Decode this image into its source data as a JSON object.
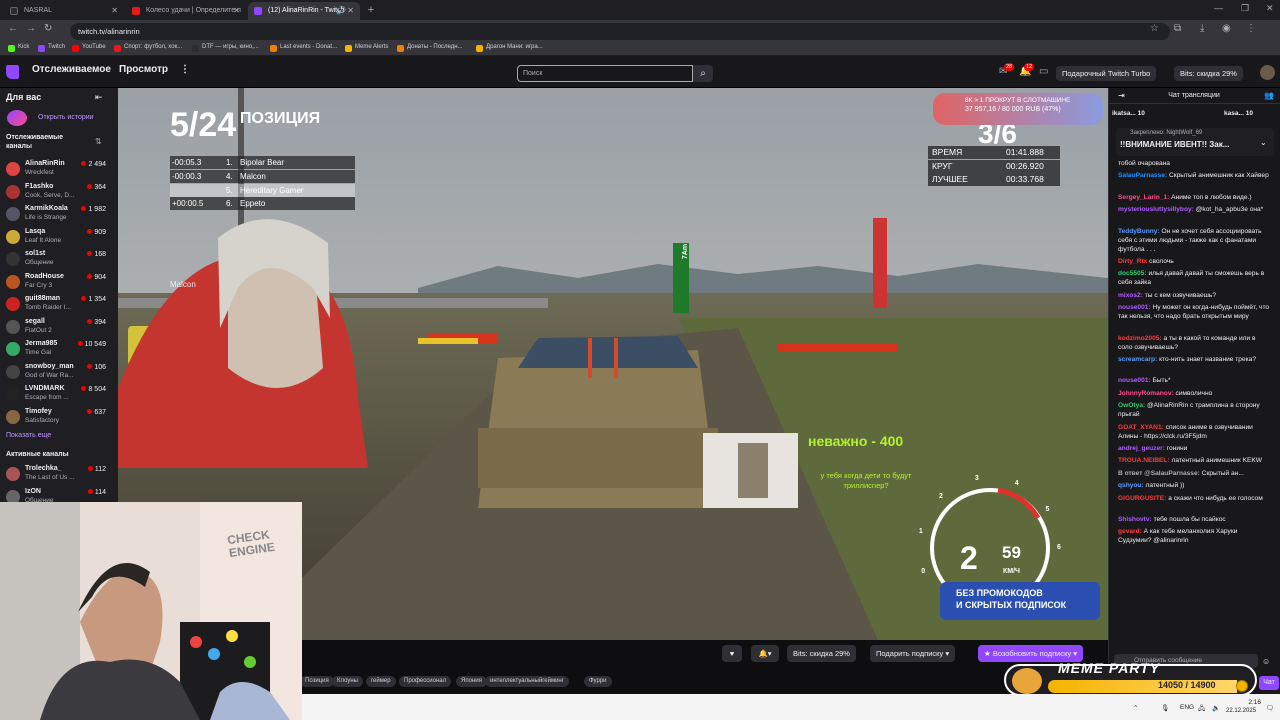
{
  "browser": {
    "tabs": [
      {
        "title": "NASRAL",
        "color": "#2d2d2d"
      },
      {
        "title": "Колесо удачи | Определите п",
        "color": "#e91916"
      },
      {
        "title": "(12) AlinaRinRin - Twitch",
        "color": "#9147ff"
      }
    ],
    "url": "twitch.tv/alinarinrin",
    "bookmarks": [
      {
        "label": "Kick",
        "color": "#53fc18"
      },
      {
        "label": "Twitch",
        "color": "#9147ff"
      },
      {
        "label": "YouTube",
        "color": "#ff0000"
      },
      {
        "label": "Спорт: футбол, хок...",
        "color": "#e91916"
      },
      {
        "label": "DTF — игры, кино,...",
        "color": "#2d2d2d"
      },
      {
        "label": "Last events - Donat...",
        "color": "#f57d07"
      },
      {
        "label": "Meme Alerts",
        "color": "#f5b300"
      },
      {
        "label": "Донаты - Последн...",
        "color": "#f57d07"
      },
      {
        "label": "Драгон Мани: игра...",
        "color": "#f5b300"
      }
    ]
  },
  "twitch": {
    "nav": {
      "following": "Отслеживаемое",
      "browse": "Просмотр",
      "more": "⋮"
    },
    "search_placeholder": "Поиск",
    "badges": {
      "inbox": "28",
      "notifications": "12"
    },
    "turbo_btn": "Подарочный Twitch Turbo",
    "bits_btn": "Bits: скидка 29%"
  },
  "sidebar": {
    "title": "Для вас",
    "story_link": "Открыть истории",
    "following_heading": "Отслеживаемые каналы",
    "channels": [
      {
        "name": "AlinaRinRin",
        "game": "Wreckfest",
        "viewers": "2 494",
        "color": "#d44"
      },
      {
        "name": "F1ashko",
        "game": "Cook, Serve, D...",
        "viewers": "364",
        "color": "#a33"
      },
      {
        "name": "KarmikKoala",
        "game": "Life is Strange",
        "viewers": "1 982",
        "color": "#556"
      },
      {
        "name": "Lasqa",
        "game": "Leaf It Alone",
        "viewers": "909",
        "color": "#ca3"
      },
      {
        "name": "sol1st",
        "game": "Общение",
        "viewers": "168",
        "color": "#333"
      },
      {
        "name": "RoadHouse",
        "game": "Far Cry 3",
        "viewers": "904",
        "color": "#b52"
      },
      {
        "name": "guit88man",
        "game": "Tomb Raider I...",
        "viewers": "1 354",
        "color": "#c22"
      },
      {
        "name": "segall",
        "game": "FlatOut 2",
        "viewers": "394",
        "color": "#555"
      },
      {
        "name": "Jerma985",
        "game": "Time Gal",
        "viewers": "10 549",
        "color": "#3a6"
      },
      {
        "name": "snowboy_man",
        "game": "God of War Ra...",
        "viewers": "106",
        "color": "#444"
      },
      {
        "name": "LVNDMARK",
        "game": "Escape from ...",
        "viewers": "8 504",
        "color": "#222"
      },
      {
        "name": "Timofey",
        "game": "Satisfactory",
        "viewers": "637",
        "color": "#864"
      }
    ],
    "show_more": "Показать еще",
    "active_heading": "Активные каналы",
    "active_channels": [
      {
        "name": "Trolechka_",
        "game": "The Last of Us ...",
        "viewers": "112",
        "color": "#a55"
      },
      {
        "name": "IzON",
        "game": "Общение",
        "viewers": "114",
        "color": "#666"
      }
    ]
  },
  "stream_overlay": {
    "position_big": "5/24",
    "position_label": "ПОЗИЦИЯ",
    "standings": [
      {
        "gap": "-00:05.3",
        "pos": "1.",
        "name": "Bipolar Bear"
      },
      {
        "gap": "-00:00.3",
        "pos": "4.",
        "name": "Malcon"
      },
      {
        "gap": "",
        "pos": "5.",
        "name": "Hereditary Gamer"
      },
      {
        "gap": "+00:00.5",
        "pos": "6.",
        "name": "Eppeto"
      }
    ],
    "lap_big": "3/6",
    "timing": [
      {
        "label": "ВРЕМЯ",
        "value": "01:41.888"
      },
      {
        "label": "КРУГ",
        "value": "00:26.920"
      },
      {
        "label": "ЛУЧШЕЕ",
        "value": "00:33.768"
      }
    ],
    "slot_line1": "8К > 1 ПРОКРУТ В СЛОТМАШИНЕ",
    "slot_line2": "37 957,16 / 80 000 RUB (47%)",
    "opponent_tag": "Malcon",
    "meme_text": "неважно - 400",
    "meme_question": "у тебя когда дети то будут триллисnер?",
    "speed": "59",
    "gear": "2",
    "speed_unit": "КМ/Ч",
    "speed_ticks": [
      "0",
      "1",
      "2",
      "3",
      "4",
      "5",
      "6"
    ],
    "promo_line1": "БЕЗ ПРОМОКОДОВ",
    "promo_line2": "И СКРЫТЫХ ПОДПИСОК",
    "ad_word": "7Am"
  },
  "controls": {
    "bits": "Bits: скидка 29%",
    "gift": "Подарить подписку",
    "resub": "Возобновить подписку"
  },
  "tags": [
    "Позиция",
    "Клоуны",
    "геймер",
    "Профессионал",
    "Япония",
    "интеллектуальныйгейминг",
    "Фурри"
  ],
  "chat": {
    "title": "Чат трансляции",
    "top_gifters": [
      {
        "name": "ikatsa...",
        "count": "10"
      },
      {
        "name": "kasa...",
        "count": "10"
      }
    ],
    "pinned_by": "Закреплено:",
    "pinned_user": "NightWolf_69",
    "pinned_text": "!!ВНИМАНИЕ ИВЕНТ!! Зак...",
    "messages": [
      {
        "user": "",
        "color": "#efeff1",
        "text": "тобой очарована"
      },
      {
        "user": "SalauParnasse:",
        "color": "#1e90ff",
        "text": "Скрытый анимешник как Хайвер"
      },
      {
        "user": "Sergey_Larin_1:",
        "color": "#ff4a8e",
        "text": "Аниме топ в любом виде.)"
      },
      {
        "user": "mysteriousluttysillyboy:",
        "color": "#b05cff",
        "text": "@kot_ha_apbu3e она*"
      },
      {
        "user": "TeddyBunny:",
        "color": "#5a9bff",
        "text": "Он не хочет себя ассоциировать себя с этими людьми - также как с фанатами футбола . . ."
      },
      {
        "user": "Dirty_Rtx",
        "color": "#ff3b3b",
        "text": "сволочь"
      },
      {
        "user": "doc5505:",
        "color": "#2ecc71",
        "text": "илья давай давай ты сможешь верь в себя зайка"
      },
      {
        "user": "mixos2:",
        "color": "#b05cff",
        "text": "ты с кем озвучиваешь?"
      },
      {
        "user": "nouse001:",
        "color": "#b05cff",
        "text": "Ну может он когда-нибудь поймёт, что так нельзя, что надо брать открытым миру"
      },
      {
        "user": "kodzimo2005:",
        "color": "#ff3b3b",
        "text": "а ты в какой то команде или в соло озвучиваешь?"
      },
      {
        "user": "screamcarp:",
        "color": "#5a9bff",
        "text": "кто-нить знает название трека?"
      },
      {
        "user": "nouse001:",
        "color": "#b05cff",
        "text": "Быть*"
      },
      {
        "user": "JohnnyRomanov:",
        "color": "#ff4a8e",
        "text": "символично"
      },
      {
        "user": "OwOtya:",
        "color": "#2ecc71",
        "text": "@AlinaRinRin с трамплина в сторону прыгай"
      },
      {
        "user": "GOAT_XYAN1:",
        "color": "#ff3b3b",
        "text": "список аниме в озвучивании Алины - https://clck.ru/3F5jdm"
      },
      {
        "user": "andrej_geuzer:",
        "color": "#b05cff",
        "text": "гонини"
      },
      {
        "user": "TROUA.NEIBEL:",
        "color": "#ff3b3b",
        "text": "латентный анимешник KEKW"
      },
      {
        "user": "В ответ @SalauParnasse:",
        "color": "#adadb8",
        "text": "Скрытый ан..."
      },
      {
        "user": "qshyou:",
        "color": "#5a9bff",
        "text": "латентный ))"
      },
      {
        "user": "GIGURGUSITE:",
        "color": "#ff3b3b",
        "text": "а скажи что нибудь ее голосом"
      },
      {
        "user": "Shishovtv:",
        "color": "#b05cff",
        "text": "тебе пошла бы псайкос"
      },
      {
        "user": "gevard:",
        "color": "#ff3b3b",
        "text": "А как тебе меланхолия Харуки Судзумии? @alinarinrin"
      }
    ],
    "input_placeholder": "Отправить сообщение",
    "chat_btn": "Чат"
  },
  "meme_party": {
    "title": "MEME PARTY",
    "progress": "14050 / 14900",
    "progress_fraction": 0.943
  },
  "webcam_sign": "CHECK ENGINE",
  "taskbar": {
    "lang": "ENG",
    "time": "2:16",
    "date": "22.12.2025"
  }
}
